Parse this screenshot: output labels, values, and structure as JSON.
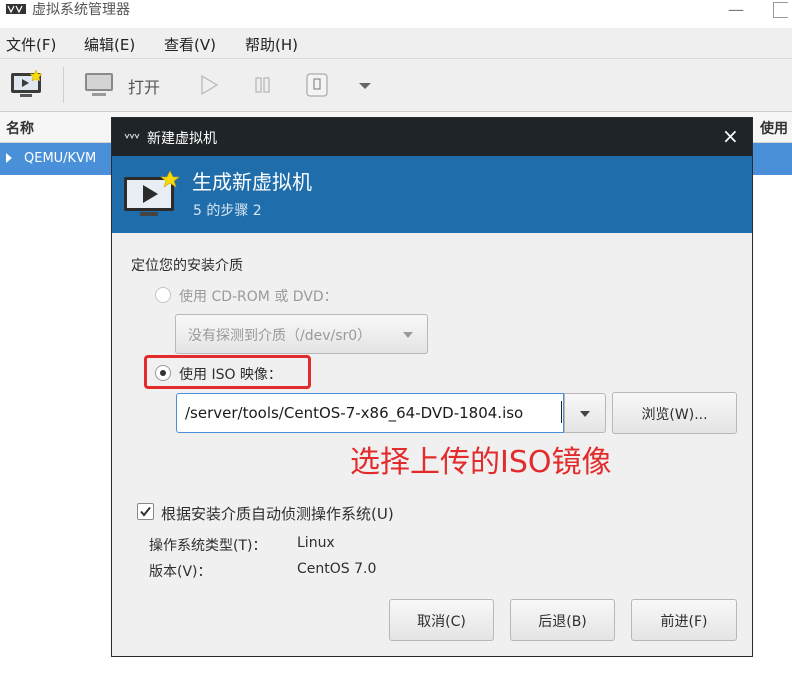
{
  "app": {
    "title": "虚拟系统管理器"
  },
  "menu": [
    "文件(F)",
    "编辑(E)",
    "查看(V)",
    "帮助(H)"
  ],
  "toolbar": {
    "open_label": "打开"
  },
  "list": {
    "header_name": "名称",
    "header_use": "使用",
    "rows": [
      "QEMU/KVM"
    ]
  },
  "dialog": {
    "title": "新建虚拟机",
    "close": "×",
    "banner_title": "生成新虚拟机",
    "banner_subtitle": "5 的步骤 2",
    "section_label": "定位您的安装介质",
    "cdrom_option": "使用 CD-ROM 或 DVD：",
    "cdrom_select": "没有探测到介质（/dev/sr0）",
    "iso_option": "使用 ISO 映像：",
    "iso_path": "/server/tools/CentOS-7-x86_64-DVD-1804.iso",
    "browse_label": "浏览(W)...",
    "annotation": "选择上传的ISO镜像",
    "auto_detect": "根据安装介质自动侦测操作系统(U)",
    "os_type_label": "操作系统类型(T)：",
    "os_type_value": "Linux",
    "version_label": "版本(V)：",
    "version_value": "CentOS 7.0",
    "cancel_label": "取消(C)",
    "back_label": "后退(B)",
    "forward_label": "前进(F)"
  },
  "colors": {
    "banner": "#1f6daa",
    "selection": "#4a90d9",
    "annotation": "#e32b2b",
    "titlebar": "#1e2428"
  }
}
